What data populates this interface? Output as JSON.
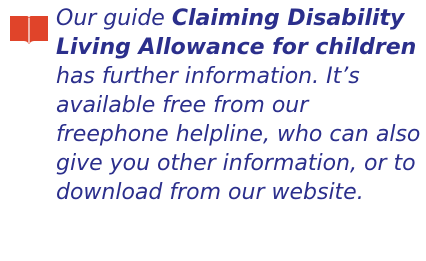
{
  "note": {
    "icon": "book-icon",
    "icon_color": "#e0442a",
    "text_color": "#2b2f8c",
    "lead": "Our guide ",
    "guide_title": "Claiming Disability Living Allowance for children",
    "body": " has further information. It’s available free from our freephone helpline, who can also give you other information, or to download from our website."
  }
}
